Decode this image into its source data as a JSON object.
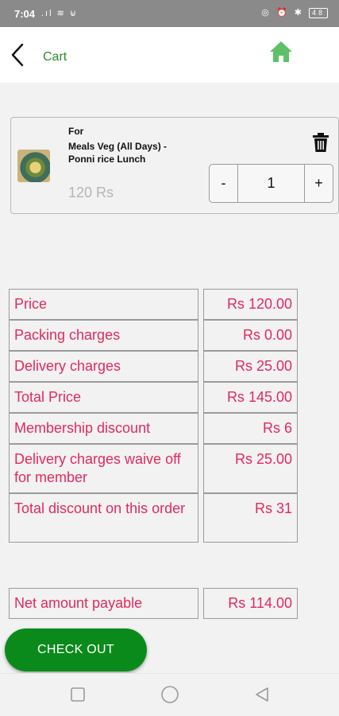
{
  "status_bar": {
    "time": "7:04",
    "left_icons": ".ıl ≋ ⊌",
    "battery": "48"
  },
  "header": {
    "title": "Cart"
  },
  "cart_item": {
    "for_label": "For",
    "name": "Meals Veg (All Days) - Ponni rice Lunch",
    "price": "120 Rs",
    "quantity": "1",
    "minus_label": "-",
    "plus_label": "+"
  },
  "summary": {
    "price_label": "Price",
    "price_value": "Rs 120.00",
    "packing_label": "Packing charges",
    "packing_value": "Rs 0.00",
    "delivery_label": "Delivery charges",
    "delivery_value": "Rs 25.00",
    "total_label": "Total Price",
    "total_value": "Rs 145.00",
    "membership_label": "Membership discount",
    "membership_value": "Rs 6",
    "waive_label": "Delivery charges waive off for member",
    "waive_value": "Rs 25.00",
    "total_discount_label": "Total discount on this order",
    "total_discount_value": "Rs 31",
    "net_label": "Net amount payable",
    "net_value": "Rs 114.00"
  },
  "checkout": {
    "label": "CHECK OUT"
  },
  "colors": {
    "accent_green": "#0b8a1c",
    "title_green": "#2a8a2a",
    "amount_pink": "#e0295f"
  }
}
